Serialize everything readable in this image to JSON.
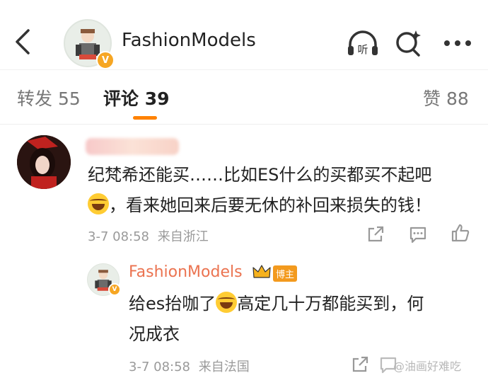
{
  "header": {
    "title": "FashionModels",
    "listen_label": "听"
  },
  "tabs": {
    "repost": {
      "label": "转发",
      "count": "55"
    },
    "comments": {
      "label": "评论",
      "count": "39"
    },
    "likes": {
      "label": "赞",
      "count": "88"
    }
  },
  "comment": {
    "text_line1": "纪梵希还能买……比如ES什么的买都买不起吧",
    "text_line2": "，看来她回来后要无休的补回来损失的钱！",
    "time": "3-7 08:58",
    "location": "来自浙江"
  },
  "reply": {
    "username": "FashionModels",
    "badge": "博主",
    "text_line1_a": "给es抬咖了",
    "text_line1_b": "高定几十万都能买到，何",
    "text_line2": "况成衣",
    "time": "3-7 08:58",
    "location": "来自法国"
  },
  "watermark": "@油画好难吃",
  "colors": {
    "accent": "#ff8200",
    "username": "#eb7350",
    "vip_badge": "#f6a623"
  }
}
